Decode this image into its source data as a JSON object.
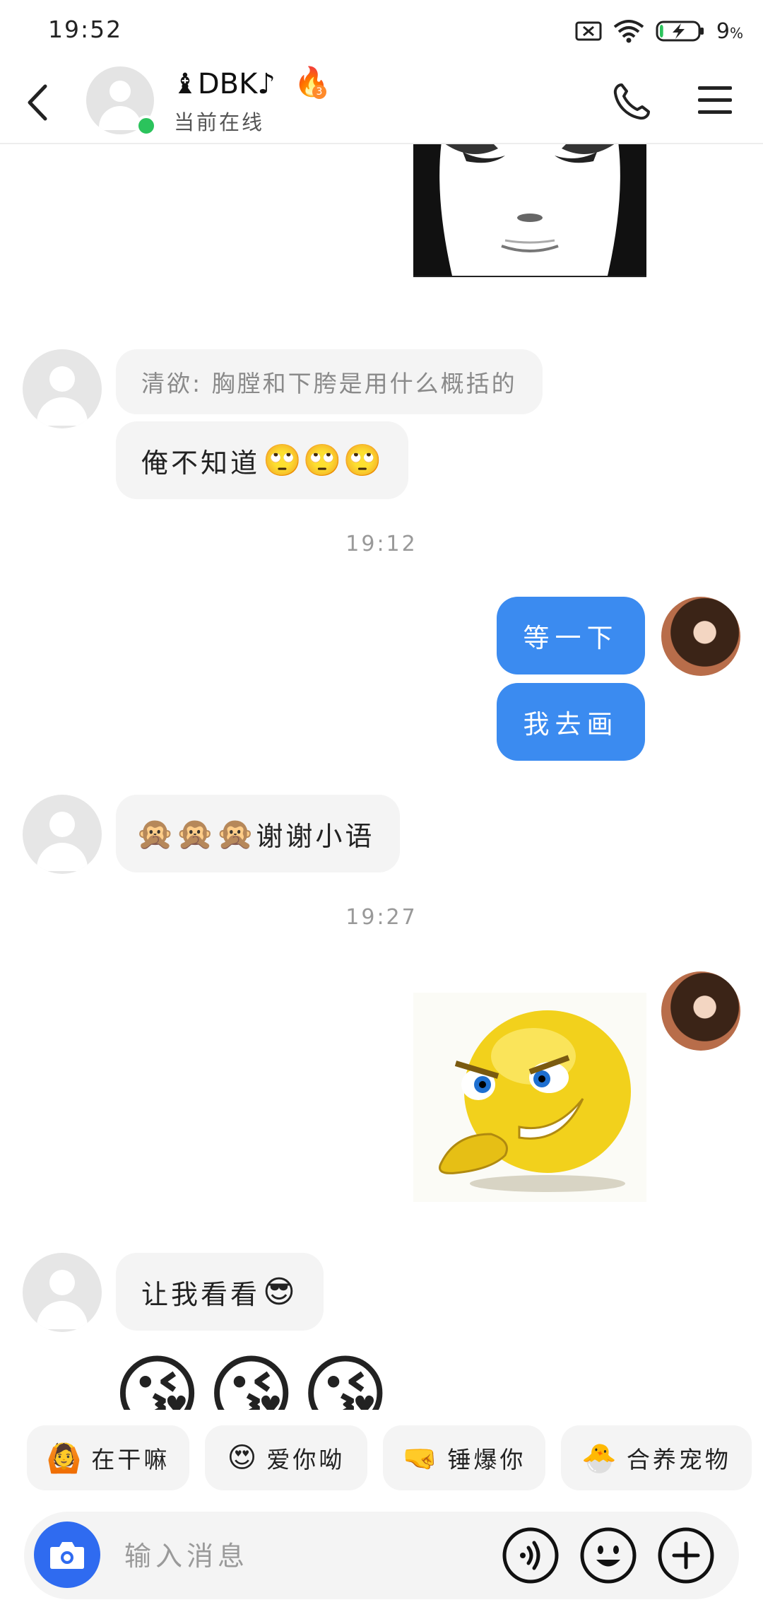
{
  "status_bar": {
    "time": "19:52",
    "battery_pct": "9",
    "battery_pct_unit": "%",
    "battery_level": 0.09,
    "icons": [
      "sim-error-icon",
      "wifi-icon",
      "battery-charging-icon"
    ]
  },
  "header": {
    "contact_name": "♝DBK♪",
    "status": "当前在线",
    "streak_icon": "fire-icon",
    "streak_count": "3"
  },
  "messages": [
    {
      "type": "image-in-partial",
      "content": "face-sticker"
    },
    {
      "type": "text-in",
      "quote": "清欲: 胸膛和下胯是用什么概括的",
      "text": "俺不知道",
      "emojis": "🙄🙄🙄"
    },
    {
      "type": "time",
      "text": "19:12"
    },
    {
      "type": "text-out",
      "text": "等一下"
    },
    {
      "type": "text-out",
      "text": "我去画"
    },
    {
      "type": "text-in",
      "emojis": "🙊🙊🙊",
      "text": "谢谢小语"
    },
    {
      "type": "time",
      "text": "19:27"
    },
    {
      "type": "image-out",
      "content": "smirk-emoji-sticker"
    },
    {
      "type": "text-in",
      "text": "让我看看",
      "emojis": "😎"
    },
    {
      "type": "emoji-in",
      "emojis": "😘😘😘"
    }
  ],
  "quick_replies": [
    {
      "icon": "🙆",
      "label": "在干嘛"
    },
    {
      "icon": "😍",
      "label": "爱你呦"
    },
    {
      "icon": "🤜",
      "label": "锤爆你"
    },
    {
      "icon": "🐣",
      "label": "合养宠物"
    }
  ],
  "input": {
    "placeholder": "输入消息",
    "buttons": [
      "camera-icon",
      "voice-icon",
      "emoji-icon",
      "plus-icon"
    ]
  },
  "colors": {
    "accent": "#3b8bf0",
    "camera": "#2f6bf0",
    "online": "#2bc35c",
    "bubble_in": "#f4f4f4"
  }
}
